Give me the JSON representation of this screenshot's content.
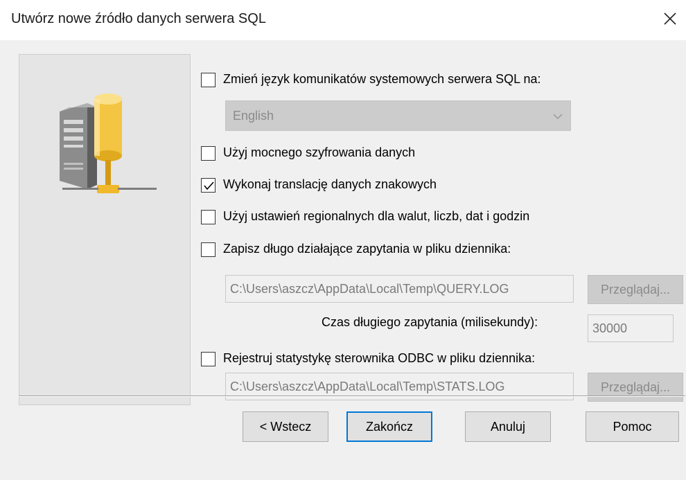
{
  "window": {
    "title": "Utwórz nowe źródło danych serwera SQL",
    "close_icon": "close-icon"
  },
  "side_panel": {
    "icon": "database-server-icon"
  },
  "options": {
    "change_language": {
      "label": "Zmień język komunikatów systemowych serwera SQL na:",
      "checked": false
    },
    "language_select": {
      "value": "English",
      "enabled": false
    },
    "strong_encryption": {
      "label": "Użyj mocnego szyfrowania danych",
      "checked": false
    },
    "char_translation": {
      "label": "Wykonaj translację danych znakowych",
      "checked": true
    },
    "regional_settings": {
      "label": "Użyj ustawień regionalnych dla walut, liczb, dat i godzin",
      "checked": false
    },
    "long_queries_log": {
      "label": "Zapisz długo działające zapytania w pliku dziennika:",
      "checked": false
    },
    "long_queries_path": {
      "value": "C:\\Users\\aszcz\\AppData\\Local\\Temp\\QUERY.LOG",
      "enabled": false
    },
    "browse_queries": {
      "label": "Przeglądaj...",
      "enabled": false
    },
    "long_query_time_label": "Czas długiego zapytania (milisekundy):",
    "long_query_time": {
      "value": "30000",
      "enabled": false
    },
    "odbc_stats_log": {
      "label": "Rejestruj statystykę sterownika ODBC w pliku dziennika:",
      "checked": false
    },
    "odbc_stats_path": {
      "value": "C:\\Users\\aszcz\\AppData\\Local\\Temp\\STATS.LOG",
      "enabled": false
    },
    "browse_stats": {
      "label": "Przeglądaj...",
      "enabled": false
    }
  },
  "buttons": {
    "back": "< Wstecz",
    "finish": "Zakończ",
    "cancel": "Anuluj",
    "help": "Pomoc"
  },
  "colors": {
    "accent": "#0078d7",
    "dialog_bg": "#f0f0f0"
  }
}
